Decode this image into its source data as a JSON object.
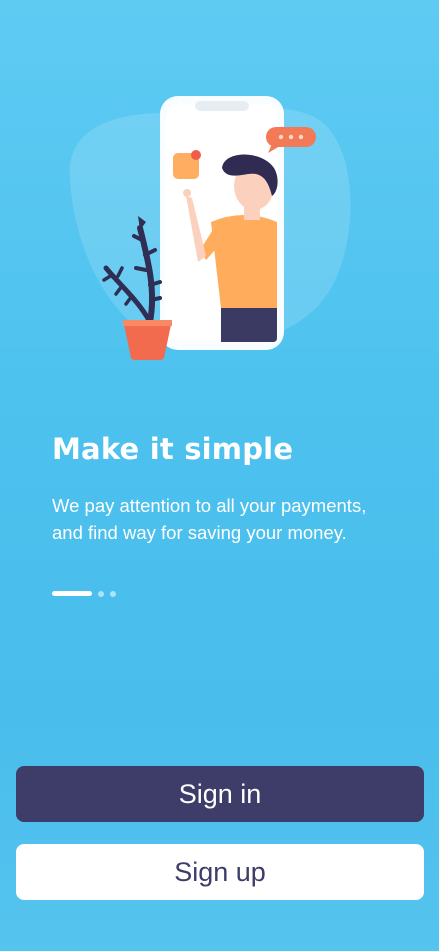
{
  "onboarding": {
    "title": "Make it simple",
    "description": "We pay attention to all your payments, and find way for saving your money.",
    "pager": {
      "total_pages": 3,
      "active_page": 1
    }
  },
  "actions": {
    "sign_in_label": "Sign in",
    "sign_up_label": "Sign up"
  },
  "colors": {
    "background": "#4cc1ee",
    "primary_button": "#3e3c68",
    "secondary_button": "#ffffff",
    "accent": "#f37a57"
  },
  "illustration": {
    "subject": "person-with-smartphone-and-plant"
  }
}
